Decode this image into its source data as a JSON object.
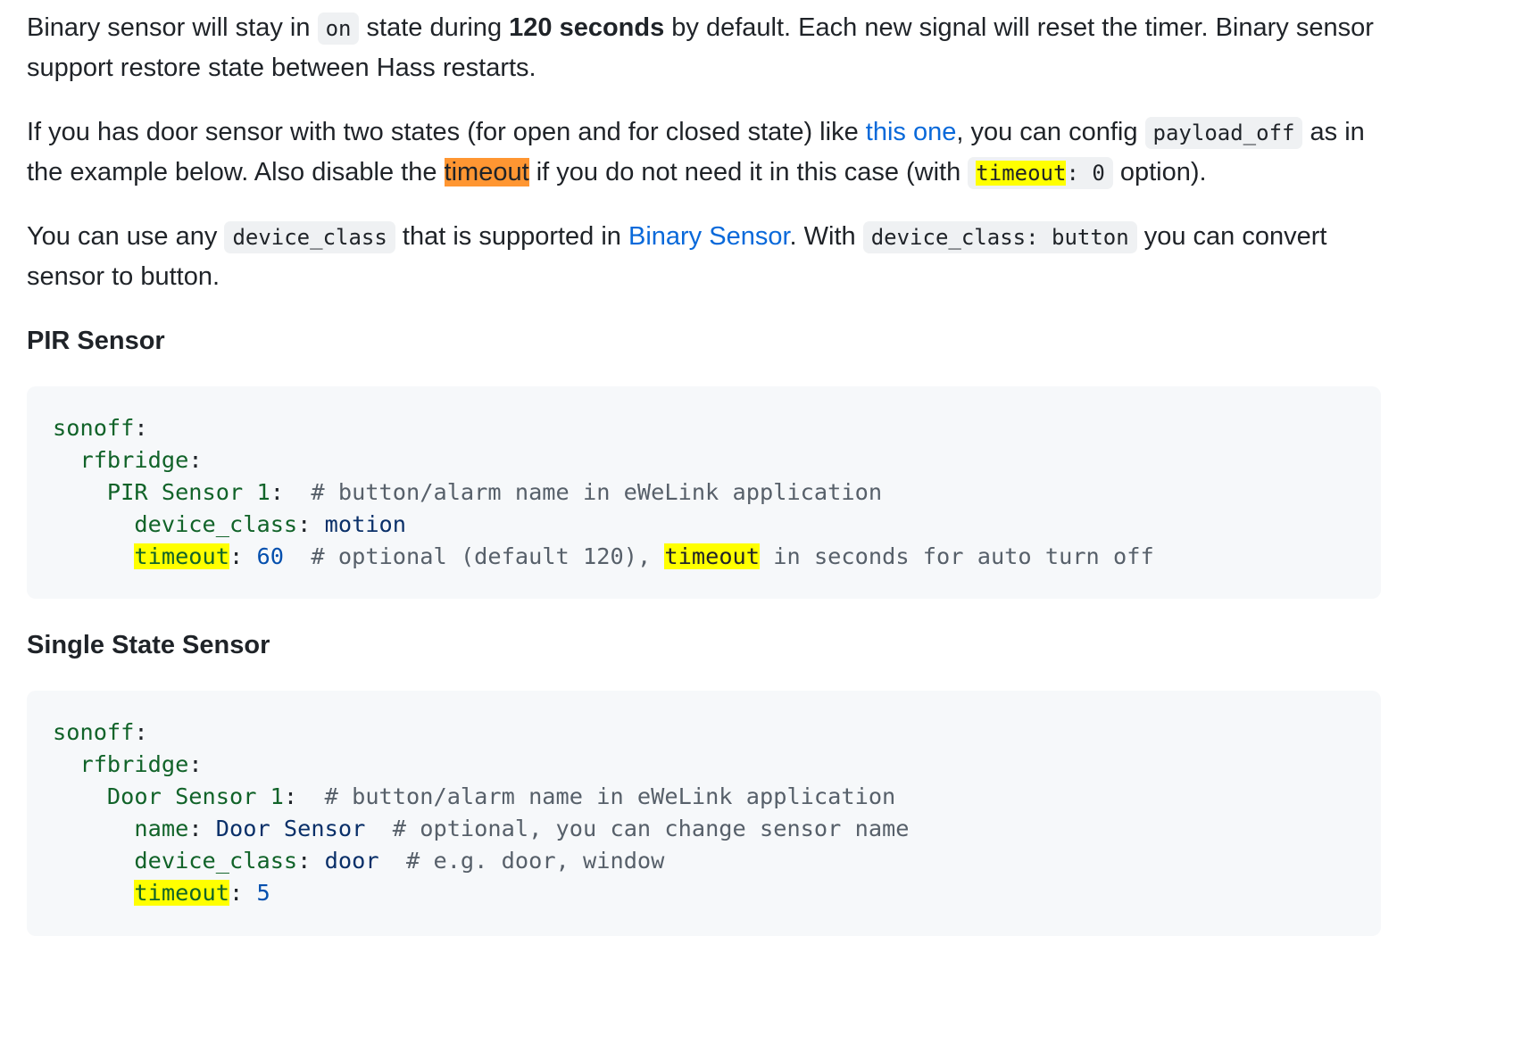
{
  "paragraphs": {
    "p1": {
      "t1": "Binary sensor will stay in ",
      "code_on": "on",
      "t2": " state during ",
      "bold": "120 seconds",
      "t3": " by default. Each new signal will reset the timer. Binary sensor support restore state between Hass restarts."
    },
    "p2": {
      "t1": "If you has door sensor with two states (for open and for closed state) like ",
      "link_this_one": "this one",
      "t2": ", you can config ",
      "code_payload_off": "payload_off",
      "t3": " as in the example below. Also disable the ",
      "highlight_timeout": "timeout",
      "t4": " if you do not need it in this case (with ",
      "code_timeout_key": "timeout",
      "code_timeout_rest": ": 0",
      "t5": " option)."
    },
    "p3": {
      "t1": "You can use any ",
      "code_device_class": "device_class",
      "t2": " that is supported in ",
      "link_binary_sensor": "Binary Sensor",
      "t3": ". With ",
      "code_device_class_button": "device_class: button",
      "t4": " you can convert sensor to button."
    }
  },
  "sections": {
    "pir": {
      "title": "PIR Sensor",
      "code": {
        "l1_key": "sonoff",
        "l2_key": "rfbridge",
        "l3_key": "PIR Sensor 1",
        "l3_comment": "# button/alarm name in eWeLink application",
        "l4_key": "device_class",
        "l4_value": "motion",
        "l5_key": "timeout",
        "l5_value": "60",
        "l5_comment_a": "# optional (default 120), ",
        "l5_comment_hl": "timeout",
        "l5_comment_b": " in seconds for auto turn off"
      }
    },
    "single": {
      "title": "Single State Sensor",
      "code": {
        "l1_key": "sonoff",
        "l2_key": "rfbridge",
        "l3_key": "Door Sensor 1",
        "l3_comment": "# button/alarm name in eWeLink application",
        "l4_key": "name",
        "l4_value": "Door Sensor",
        "l4_comment": "# optional, you can change sensor name",
        "l5_key": "device_class",
        "l5_value": "door",
        "l5_comment": "# e.g. door, window",
        "l6_key": "timeout",
        "l6_value": "5"
      }
    }
  },
  "colors": {
    "link": "#0969da",
    "highlight_current": "#ff9632",
    "highlight_match": "#ffff00",
    "code_key": "#116329",
    "code_string": "#0a3069",
    "code_number": "#0550ae",
    "code_comment": "#57606a",
    "code_background": "#f6f8fa"
  }
}
